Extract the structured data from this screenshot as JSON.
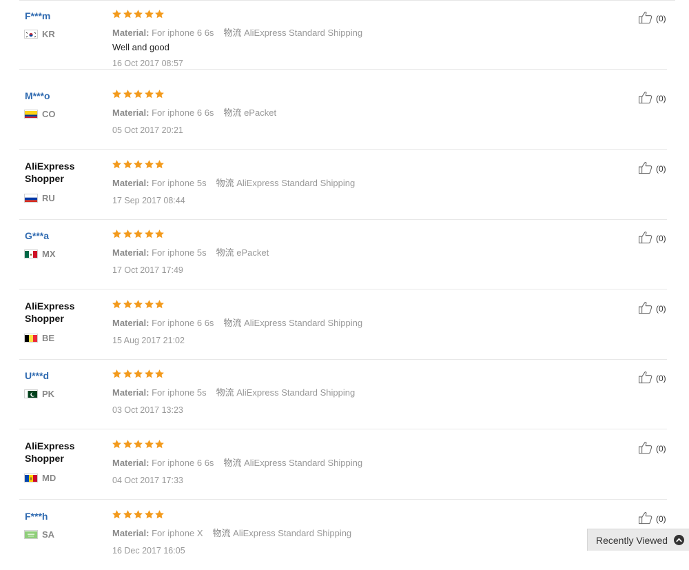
{
  "reviews": [
    {
      "buyer": "F***m",
      "buyer_type": "masked",
      "country": "KR",
      "rating": 5,
      "material_label": "Material:",
      "material": "For iphone 6 6s",
      "shipping_label": "物流",
      "shipping": "AliExpress Standard Shipping",
      "feedback": "Well and good",
      "date": "16 Oct 2017 08:57",
      "useful": "(0)"
    },
    {
      "buyer": "M***o",
      "buyer_type": "masked",
      "country": "CO",
      "rating": 5,
      "material_label": "Material:",
      "material": "For iphone 6 6s",
      "shipping_label": "物流",
      "shipping": "ePacket",
      "feedback": "",
      "date": "05 Oct 2017 20:21",
      "useful": "(0)"
    },
    {
      "buyer": "AliExpress Shopper",
      "buyer_type": "generic",
      "country": "RU",
      "rating": 5,
      "material_label": "Material:",
      "material": "For iphone 5s",
      "shipping_label": "物流",
      "shipping": "AliExpress Standard Shipping",
      "feedback": "",
      "date": "17 Sep 2017 08:44",
      "useful": "(0)"
    },
    {
      "buyer": "G***a",
      "buyer_type": "masked",
      "country": "MX",
      "rating": 5,
      "material_label": "Material:",
      "material": "For iphone 5s",
      "shipping_label": "物流",
      "shipping": "ePacket",
      "feedback": "",
      "date": "17 Oct 2017 17:49",
      "useful": "(0)"
    },
    {
      "buyer": "AliExpress Shopper",
      "buyer_type": "generic",
      "country": "BE",
      "rating": 5,
      "material_label": "Material:",
      "material": "For iphone 6 6s",
      "shipping_label": "物流",
      "shipping": "AliExpress Standard Shipping",
      "feedback": "",
      "date": "15 Aug 2017 21:02",
      "useful": "(0)"
    },
    {
      "buyer": "U***d",
      "buyer_type": "masked",
      "country": "PK",
      "rating": 5,
      "material_label": "Material:",
      "material": "For iphone 5s",
      "shipping_label": "物流",
      "shipping": "AliExpress Standard Shipping",
      "feedback": "",
      "date": "03 Oct 2017 13:23",
      "useful": "(0)"
    },
    {
      "buyer": "AliExpress Shopper",
      "buyer_type": "generic",
      "country": "MD",
      "rating": 5,
      "material_label": "Material:",
      "material": "For iphone 6 6s",
      "shipping_label": "物流",
      "shipping": "AliExpress Standard Shipping",
      "feedback": "",
      "date": "04 Oct 2017 17:33",
      "useful": "(0)"
    },
    {
      "buyer": "F***h",
      "buyer_type": "masked",
      "country": "SA",
      "rating": 5,
      "material_label": "Material:",
      "material": "For iphone X",
      "shipping_label": "物流",
      "shipping": "AliExpress Standard Shipping",
      "feedback": "",
      "date": "16 Dec 2017 16:05",
      "useful": "(0)"
    }
  ],
  "colors": {
    "star": "#f39a1c",
    "masked_name": "#2f6ab0",
    "generic_name": "#111111",
    "meta_text": "#999999"
  },
  "icons": {
    "useful": "thumbs-up-icon",
    "rating": "star-icon",
    "recently": "chevron-up-icon"
  },
  "recently_viewed": {
    "label": "Recently Viewed"
  }
}
